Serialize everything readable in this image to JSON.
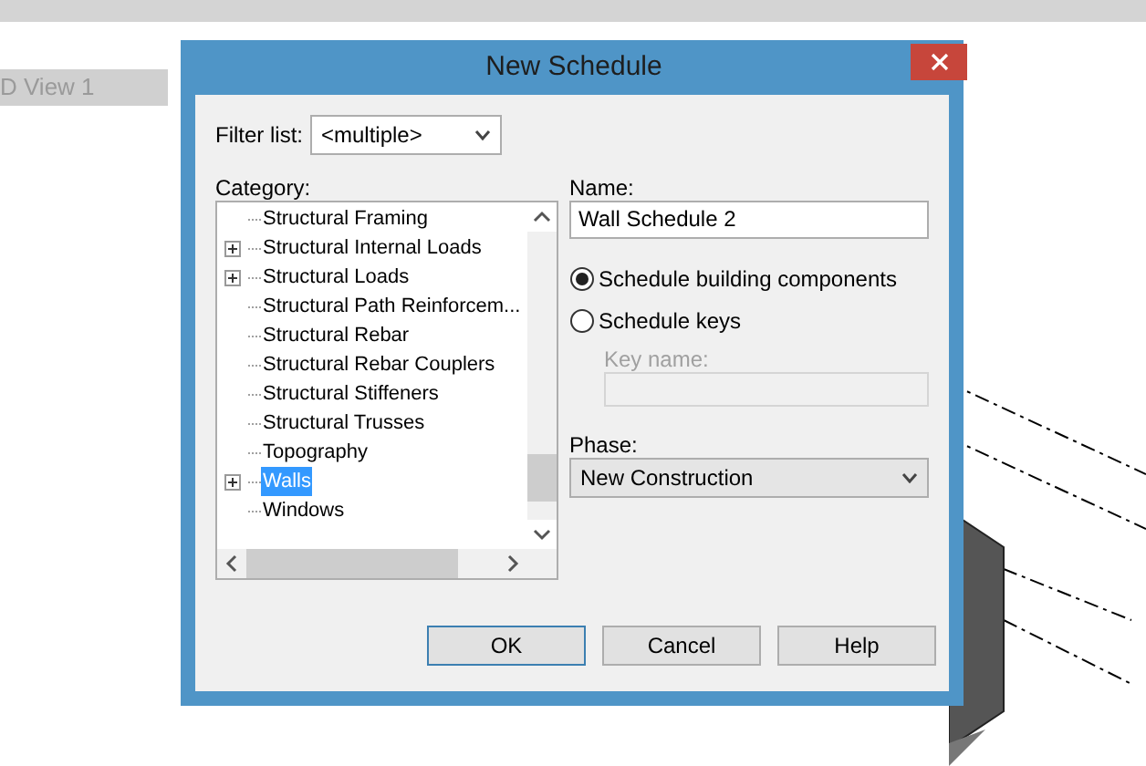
{
  "background": {
    "view_tab": "D View 1"
  },
  "dialog": {
    "title": "New Schedule",
    "filter": {
      "label": "Filter list:",
      "value": "<multiple>"
    },
    "category": {
      "label": "Category:",
      "items": [
        {
          "label": "Structural Framing",
          "expandable": false,
          "selected": false
        },
        {
          "label": "Structural Internal Loads",
          "expandable": true,
          "selected": false
        },
        {
          "label": "Structural Loads",
          "expandable": true,
          "selected": false
        },
        {
          "label": "Structural Path Reinforcem...",
          "expandable": false,
          "selected": false
        },
        {
          "label": "Structural Rebar",
          "expandable": false,
          "selected": false
        },
        {
          "label": "Structural Rebar Couplers",
          "expandable": false,
          "selected": false
        },
        {
          "label": "Structural Stiffeners",
          "expandable": false,
          "selected": false
        },
        {
          "label": "Structural Trusses",
          "expandable": false,
          "selected": false
        },
        {
          "label": "Topography",
          "expandable": false,
          "selected": false
        },
        {
          "label": "Walls",
          "expandable": true,
          "selected": true
        },
        {
          "label": "Windows",
          "expandable": false,
          "selected": false
        }
      ]
    },
    "name": {
      "label": "Name:",
      "value": "Wall Schedule 2"
    },
    "options": [
      {
        "label": "Schedule building components",
        "selected": true
      },
      {
        "label": "Schedule keys",
        "selected": false
      }
    ],
    "key_name": {
      "label": "Key name:",
      "disabled": true
    },
    "phase": {
      "label": "Phase:",
      "value": "New Construction"
    },
    "buttons": [
      {
        "label": "OK",
        "default": true
      },
      {
        "label": "Cancel",
        "default": false
      },
      {
        "label": "Help",
        "default": false
      }
    ]
  }
}
